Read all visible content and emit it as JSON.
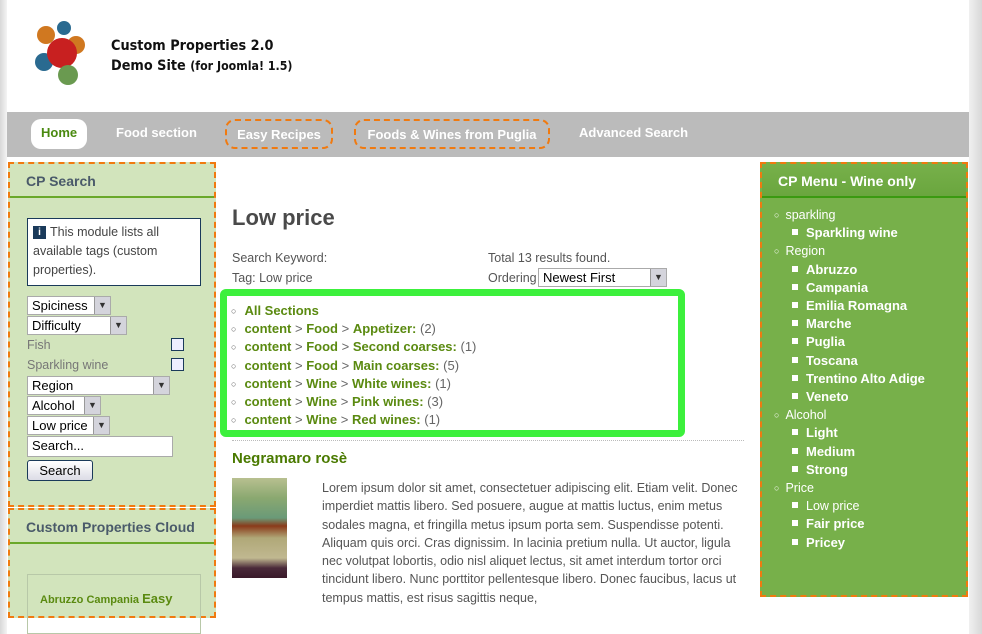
{
  "header": {
    "title_line1": "Custom Properties 2.0",
    "title_line2": "Demo Site",
    "title_suffix": "(for Joomla! 1.5)",
    "logo_icon": "molecule-logo"
  },
  "nav": {
    "items": [
      {
        "label": "Home",
        "active": true
      },
      {
        "label": "Food section"
      },
      {
        "label": "Easy Recipes",
        "highlighted": true
      },
      {
        "label": "Foods & Wines from Puglia",
        "highlighted": true
      },
      {
        "label": "Advanced Search"
      }
    ]
  },
  "cp_search": {
    "title": "CP Search",
    "info": "This module lists all available tags (custom properties).",
    "spiciness": "Spiciness",
    "difficulty": "Difficulty",
    "fish": "Fish",
    "sparkling": "Sparkling wine",
    "region": "Region",
    "alcohol": "Alcohol",
    "price": "Low price",
    "search_value": "Search...",
    "search_button": "Search"
  },
  "cloud": {
    "title": "Custom Properties Cloud",
    "tags": [
      "Abruzzo",
      "Campania",
      "Easy"
    ]
  },
  "main": {
    "title": "Low price",
    "search_keyword_label": "Search Keyword:",
    "tag_label": "Tag: Low price",
    "total": "Total 13 results found.",
    "ordering_label": "Ordering",
    "ordering_value": "Newest First",
    "sections": [
      {
        "all": "All Sections"
      },
      {
        "root": "content",
        "parent": "Food",
        "name": "Appetizer:",
        "count": "(2)"
      },
      {
        "root": "content",
        "parent": "Food",
        "name": "Second coarses:",
        "count": "(1)"
      },
      {
        "root": "content",
        "parent": "Food",
        "name": "Main coarses:",
        "count": "(5)"
      },
      {
        "root": "content",
        "parent": "Wine",
        "name": "White wines:",
        "count": "(1)"
      },
      {
        "root": "content",
        "parent": "Wine",
        "name": "Pink wines:",
        "count": "(3)"
      },
      {
        "root": "content",
        "parent": "Wine",
        "name": "Red wines:",
        "count": "(1)"
      }
    ],
    "article_title": "Negramaro rosè",
    "article_body": "Lorem ipsum dolor sit amet, consectetuer adipiscing elit. Etiam velit. Donec imperdiet mattis libero. Sed posuere, augue at mattis luctus, enim metus sodales magna, et fringilla metus ipsum porta sem. Suspendisse potenti. Aliquam quis orci. Cras dignissim. In lacinia pretium nulla. Ut auctor, ligula nec volutpat lobortis, odio nisl aliquet lectus, sit amet interdum tortor orci tincidunt libero. Nunc porttitor pellentesque libero. Donec faucibus, lacus ut tempus mattis, est risus sagittis neque,"
  },
  "right_menu": {
    "title": "CP Menu - Wine only",
    "groups": [
      {
        "label": "sparkling",
        "items": [
          "Sparkling wine"
        ]
      },
      {
        "label": "Region",
        "items": [
          "Abruzzo",
          "Campania",
          "Emilia Romagna",
          "Marche",
          "Puglia",
          "Toscana",
          "Trentino Alto Adige",
          "Veneto"
        ]
      },
      {
        "label": "Alcohol",
        "items": [
          "Light",
          "Medium",
          "Strong"
        ]
      },
      {
        "label": "Price",
        "items": [
          "Low price",
          "Fair price",
          "Pricey"
        ]
      }
    ]
  },
  "colors": {
    "accent_green": "#5a8a10",
    "highlight_border": "#3cf03c",
    "dash_orange": "#f07a10",
    "right_bg": "#77b04a",
    "left_bg": "#d2e4bc"
  }
}
